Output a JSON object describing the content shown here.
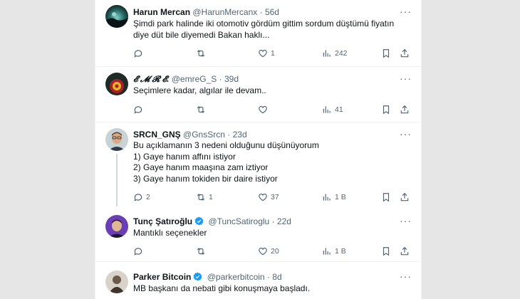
{
  "colors": {
    "accent": "#1d9bf0",
    "text": "#0f1419",
    "muted": "#536471",
    "divider": "#eff3f4",
    "thread_line": "#cfd9de"
  },
  "tweets": [
    {
      "name": "Harun Mercan",
      "handle": "@HarunMercanx",
      "dot": "·",
      "time": "56d",
      "verified": false,
      "lines": [
        "Şimdi park halinde iki otomotiv gördüm  gittim sordum düştümü fiyatın",
        "diye düt bile diyemedi Bakan haklı..."
      ],
      "replies": "",
      "retweets": "",
      "likes": "1",
      "views": "242",
      "more": "···"
    },
    {
      "name": "𝓔 𝓜 𝓡 𝓔.",
      "handle": "@emreG_S",
      "dot": "·",
      "time": "39d",
      "verified": false,
      "lines": [
        "Seçimlere kadar, algılar ile devam.."
      ],
      "replies": "",
      "retweets": "",
      "likes": "",
      "views": "41",
      "more": "···"
    },
    {
      "name": "SRCN_GNŞ",
      "handle": "@GnsSrcn",
      "dot": "·",
      "time": "23d",
      "verified": false,
      "lines": [
        "Bu açıklamanın 3 nedeni olduğunu düşünüyorum",
        "1) Gaye hanım affını istiyor",
        "2) Gaye hanım maaşına zam iztiyor",
        "3) Gaye hanım tokiden bir daire istiyor"
      ],
      "replies": "2",
      "retweets": "1",
      "likes": "37",
      "views": "1 B",
      "more": "···"
    },
    {
      "name": "Tunç Şatıroğlu",
      "handle": "@TuncSatiroglu",
      "dot": "·",
      "time": "22d",
      "verified": true,
      "lines": [
        "Mantıklı seçenekler"
      ],
      "replies": "",
      "retweets": "",
      "likes": "20",
      "views": "1 B",
      "more": "···"
    },
    {
      "name": "Parker Bitcoin",
      "handle": "@parkerbitcoin",
      "dot": "·",
      "time": "8d",
      "verified": true,
      "lines": [
        "MB başkanı da nebati gibi konuşmaya başladı."
      ],
      "replies": "",
      "retweets": "",
      "likes": "",
      "views": "",
      "more": "···"
    }
  ]
}
